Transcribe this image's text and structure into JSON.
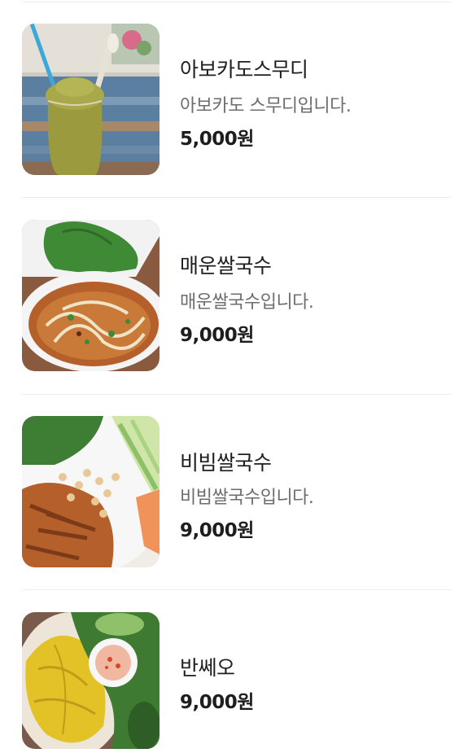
{
  "menu_items": [
    {
      "name": "아보카도스무디",
      "description": "아보카도 스무디입니다.",
      "price": "5,000원",
      "image": "avocado-smoothie-photo"
    },
    {
      "name": "매운쌀국수",
      "description": "매운쌀국수입니다.",
      "price": "9,000원",
      "image": "spicy-rice-noodle-soup-photo"
    },
    {
      "name": "비빔쌀국수",
      "description": "비빔쌀국수입니다.",
      "price": "9,000원",
      "image": "bibim-rice-noodle-photo"
    },
    {
      "name": "반쎄오",
      "price": "9,000원",
      "image": "banh-xeo-photo"
    }
  ]
}
